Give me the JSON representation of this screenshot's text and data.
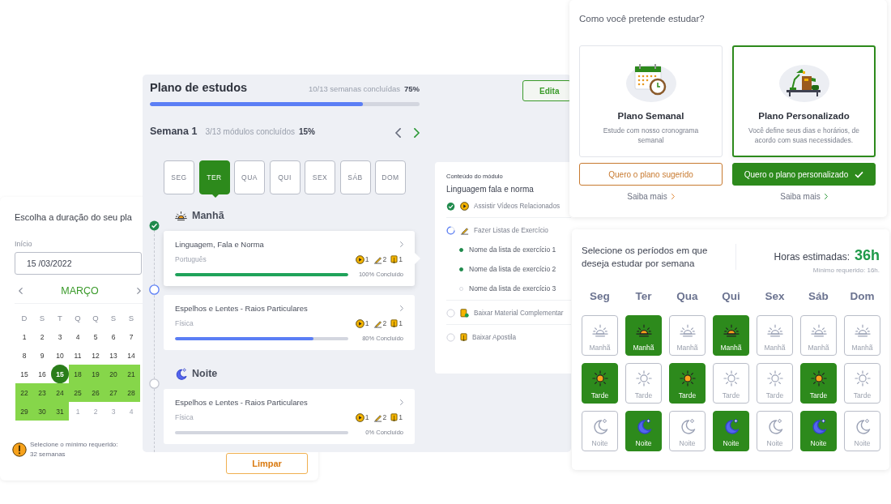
{
  "calendar_card": {
    "title": "Escolha a duração do seu pla",
    "start_label": "Início",
    "start_value": "15 /03/2022",
    "month": "MARÇO",
    "weekdays": [
      "D",
      "S",
      "T",
      "Q",
      "Q",
      "S",
      "S"
    ],
    "days": [
      {
        "day": "1",
        "kind": "normal"
      },
      {
        "day": "2",
        "kind": "normal"
      },
      {
        "day": "3",
        "kind": "normal"
      },
      {
        "day": "4",
        "kind": "normal"
      },
      {
        "day": "5",
        "kind": "normal"
      },
      {
        "day": "6",
        "kind": "normal"
      },
      {
        "day": "7",
        "kind": "normal"
      },
      {
        "day": "8",
        "kind": "normal"
      },
      {
        "day": "9",
        "kind": "normal"
      },
      {
        "day": "10",
        "kind": "normal"
      },
      {
        "day": "11",
        "kind": "normal"
      },
      {
        "day": "12",
        "kind": "normal"
      },
      {
        "day": "13",
        "kind": "normal"
      },
      {
        "day": "14",
        "kind": "normal"
      },
      {
        "day": "15",
        "kind": "normal"
      },
      {
        "day": "16",
        "kind": "normal"
      },
      {
        "day": "15",
        "kind": "selected"
      },
      {
        "day": "18",
        "kind": "range"
      },
      {
        "day": "19",
        "kind": "range"
      },
      {
        "day": "20",
        "kind": "range"
      },
      {
        "day": "21",
        "kind": "range"
      },
      {
        "day": "22",
        "kind": "range"
      },
      {
        "day": "23",
        "kind": "range"
      },
      {
        "day": "24",
        "kind": "range"
      },
      {
        "day": "25",
        "kind": "range"
      },
      {
        "day": "26",
        "kind": "range"
      },
      {
        "day": "27",
        "kind": "range"
      },
      {
        "day": "28",
        "kind": "range"
      },
      {
        "day": "29",
        "kind": "range"
      },
      {
        "day": "30",
        "kind": "range"
      },
      {
        "day": "31",
        "kind": "range"
      },
      {
        "day": "1",
        "kind": "other"
      },
      {
        "day": "2",
        "kind": "other"
      },
      {
        "day": "3",
        "kind": "other"
      },
      {
        "day": "4",
        "kind": "other"
      }
    ],
    "warning": [
      "Selecione o mínimo requerido:",
      "32 semanas"
    ],
    "clear_button": "Limpar"
  },
  "study_plan": {
    "title": "Plano de estudos",
    "weeks_done": "10/13 semanas concluídas",
    "weeks_percent": "75%",
    "level": 0.79,
    "edit_button": "Edita",
    "week": {
      "label": "Semana 1",
      "modules_done": "3/13 módulos concluídos",
      "percent": "15%"
    },
    "days": [
      {
        "label": "SEG",
        "selected": false
      },
      {
        "label": "TER",
        "selected": true
      },
      {
        "label": "QUA",
        "selected": false
      },
      {
        "label": "QUI",
        "selected": false
      },
      {
        "label": "SEX",
        "selected": false
      },
      {
        "label": "SÁB",
        "selected": false
      },
      {
        "label": "DOM",
        "selected": false
      }
    ],
    "periods": [
      {
        "name": "Manhã",
        "kind": "morning",
        "modules": [
          {
            "title": "Linguagem, Fala e Norma",
            "subject": "Português",
            "done": true,
            "selected": true,
            "level": 1,
            "progress_text": "100% Concluído",
            "counts": [
              {
                "kind": "video",
                "value": "1"
              },
              {
                "kind": "exercise",
                "value": "2"
              },
              {
                "kind": "handout",
                "value": "1"
              }
            ]
          },
          {
            "title": "Espelhos e Lentes - Raios Particulares",
            "subject": "Física",
            "done": false,
            "started": true,
            "selected": false,
            "level": 0.8,
            "progress_text": "80% Concluído",
            "counts": [
              {
                "kind": "video",
                "value": "1"
              },
              {
                "kind": "exercise",
                "value": "2"
              },
              {
                "kind": "handout",
                "value": "1"
              }
            ]
          }
        ]
      },
      {
        "name": "Noite",
        "kind": "night",
        "modules": [
          {
            "title": "Espelhos e Lentes - Raios Particulares",
            "subject": "Física",
            "done": false,
            "started": false,
            "selected": false,
            "level": 0,
            "progress_text": "0% Concluído",
            "counts": [
              {
                "kind": "video",
                "value": "1"
              },
              {
                "kind": "exercise",
                "value": "2"
              },
              {
                "kind": "handout",
                "value": "1"
              }
            ]
          }
        ]
      }
    ]
  },
  "module_content": {
    "label": "Conteúdo do módulo",
    "title": "Linguagem fala e norma",
    "tasks": [
      {
        "label": "Assistir Vídeos Relacionados",
        "kind": "video",
        "done": true
      },
      {
        "label": "Fazer Listas de Exercício",
        "kind": "exercise",
        "done": false,
        "started": true,
        "lists": [
          {
            "label": "Nome da lista de exercício 1",
            "done": true
          },
          {
            "label": "Nome da lista de exercício 2",
            "done": true
          },
          {
            "label": "Nome da lista de exercício 3",
            "done": false
          }
        ]
      },
      {
        "label": "Baixar Material Complementar",
        "kind": "material",
        "done": false,
        "started": false
      },
      {
        "label": "Baixar Apostila",
        "kind": "handout",
        "done": false,
        "started": false
      }
    ]
  },
  "plan_choice": {
    "question": "Como você pretende estudar?",
    "options": [
      {
        "kind": "weekly",
        "title": "Plano Semanal",
        "description": "Estude com nosso cronograma semanal",
        "button": "Quero o plano sugerido",
        "link": "Saiba mais",
        "selected": false
      },
      {
        "kind": "custom",
        "title": "Plano Personalizado",
        "description": "Você define seus dias e horários, de acordo com suas necessidades.",
        "button": "Quero o plano personalizado",
        "link": "Saiba mais",
        "selected": true
      }
    ]
  },
  "period_picker": {
    "prompt": "Selecione os períodos em que deseja estudar por semana",
    "hours_label": "Horas estimadas:",
    "hours_value": "36h",
    "minimum": "Mínimo requerido: 16h.",
    "days": [
      "Seg",
      "Ter",
      "Qua",
      "Qui",
      "Sex",
      "Sáb",
      "Dom"
    ],
    "rows": [
      {
        "kind": "morning",
        "cells": [
          {
            "label": "Manhã",
            "selected": false
          },
          {
            "label": "Manhã",
            "selected": true
          },
          {
            "label": "Manhã",
            "selected": false
          },
          {
            "label": "Manhã",
            "selected": true
          },
          {
            "label": "Manhã",
            "selected": false
          },
          {
            "label": "Manhã",
            "selected": false
          },
          {
            "label": "Manhã",
            "selected": false
          }
        ]
      },
      {
        "kind": "afternoon",
        "cells": [
          {
            "label": "Tarde",
            "selected": true
          },
          {
            "label": "Tarde",
            "selected": false
          },
          {
            "label": "Tarde",
            "selected": true
          },
          {
            "label": "Tarde",
            "selected": false
          },
          {
            "label": "Tarde",
            "selected": false
          },
          {
            "label": "Tarde",
            "selected": true
          },
          {
            "label": "Tarde",
            "selected": false
          }
        ]
      },
      {
        "kind": "night",
        "cells": [
          {
            "label": "Noite",
            "selected": false
          },
          {
            "label": "Noite",
            "selected": true
          },
          {
            "label": "Noite",
            "selected": false
          },
          {
            "label": "Noite",
            "selected": true
          },
          {
            "label": "Noite",
            "selected": false
          },
          {
            "label": "Noite",
            "selected": true
          },
          {
            "label": "Noite",
            "selected": false
          }
        ]
      }
    ]
  }
}
